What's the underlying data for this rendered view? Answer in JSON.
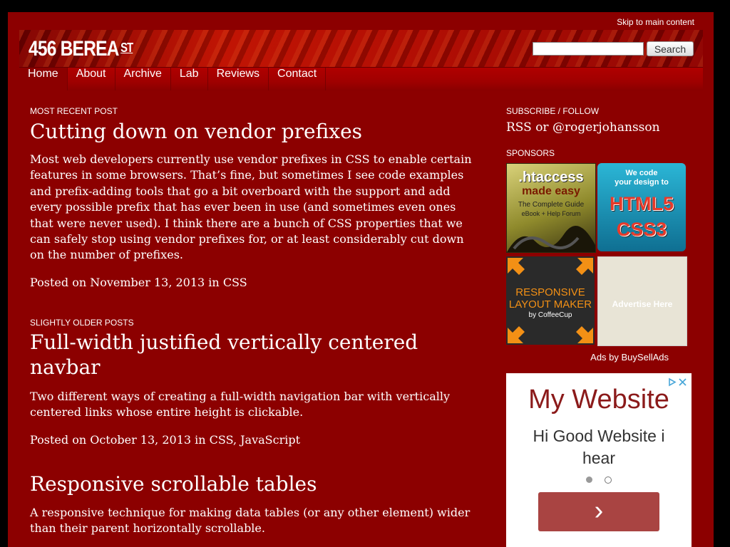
{
  "skip_link": "Skip to main content",
  "logo": {
    "main": "456 BEREA",
    "sup": "ST"
  },
  "search": {
    "placeholder": "",
    "button_label": "Search"
  },
  "nav": [
    "Home",
    "About",
    "Archive",
    "Lab",
    "Reviews",
    "Contact"
  ],
  "recent": {
    "label": "MOST RECENT POST",
    "title": "Cutting down on vendor prefixes",
    "body": "Most web developers currently use vendor prefixes in CSS to enable certain features in some browsers. That’s fine, but sometimes I see code examples and prefix-adding tools that go a bit overboard with the support and add every possible prefix that has ever been in use (and sometimes even ones that were never used). I think there are a bunch of CSS properties that we can safely stop using vendor prefixes for, or at least considerably cut down on the number of prefixes.",
    "meta_prefix": "Posted on November 13, 2013 in ",
    "category": "CSS"
  },
  "older": {
    "label": "SLIGHTLY OLDER POSTS",
    "posts": [
      {
        "title": "Full-width justified vertically centered navbar",
        "body": "Two different ways of creating a full-width navigation bar with vertically centered links whose entire height is clickable.",
        "meta_prefix": "Posted on October 13, 2013 in ",
        "cat1": "CSS",
        "sep": ", ",
        "cat2": "JavaScript"
      },
      {
        "title": "Responsive scrollable tables",
        "body": "A responsive technique for making data tables (or any other element) wider than their parent horizontally scrollable."
      }
    ]
  },
  "sidebar": {
    "subscribe_label": "SUBSCRIBE / FOLLOW",
    "rss": "RSS",
    "or": " or ",
    "twitter": "@rogerjohansson",
    "sponsors_label": "SPONSORS",
    "ads": {
      "htaccess": {
        "line1": ".htaccess",
        "line2": "made easy",
        "line3": "The Complete Guide",
        "line4": "eBook + Help Forum"
      },
      "html5": {
        "line1": "We code",
        "line2": "your design to",
        "line3": "HTML5",
        "line4": "CSS3"
      },
      "layout": {
        "line1": "RESPONSIVE",
        "line2": "LAYOUT MAKER",
        "line3": "by CoffeeCup"
      },
      "advertise": "Advertise Here"
    },
    "ads_by": "Ads by BuySellAds"
  },
  "widget": {
    "title": "My Website",
    "subtitle": "Hi Good Website i hear",
    "arrow": "›"
  },
  "colors": {
    "page_bg": "#8c0000",
    "outer_bg": "#000000",
    "widget_title": "#8b1a1a",
    "widget_button": "#a94442"
  }
}
